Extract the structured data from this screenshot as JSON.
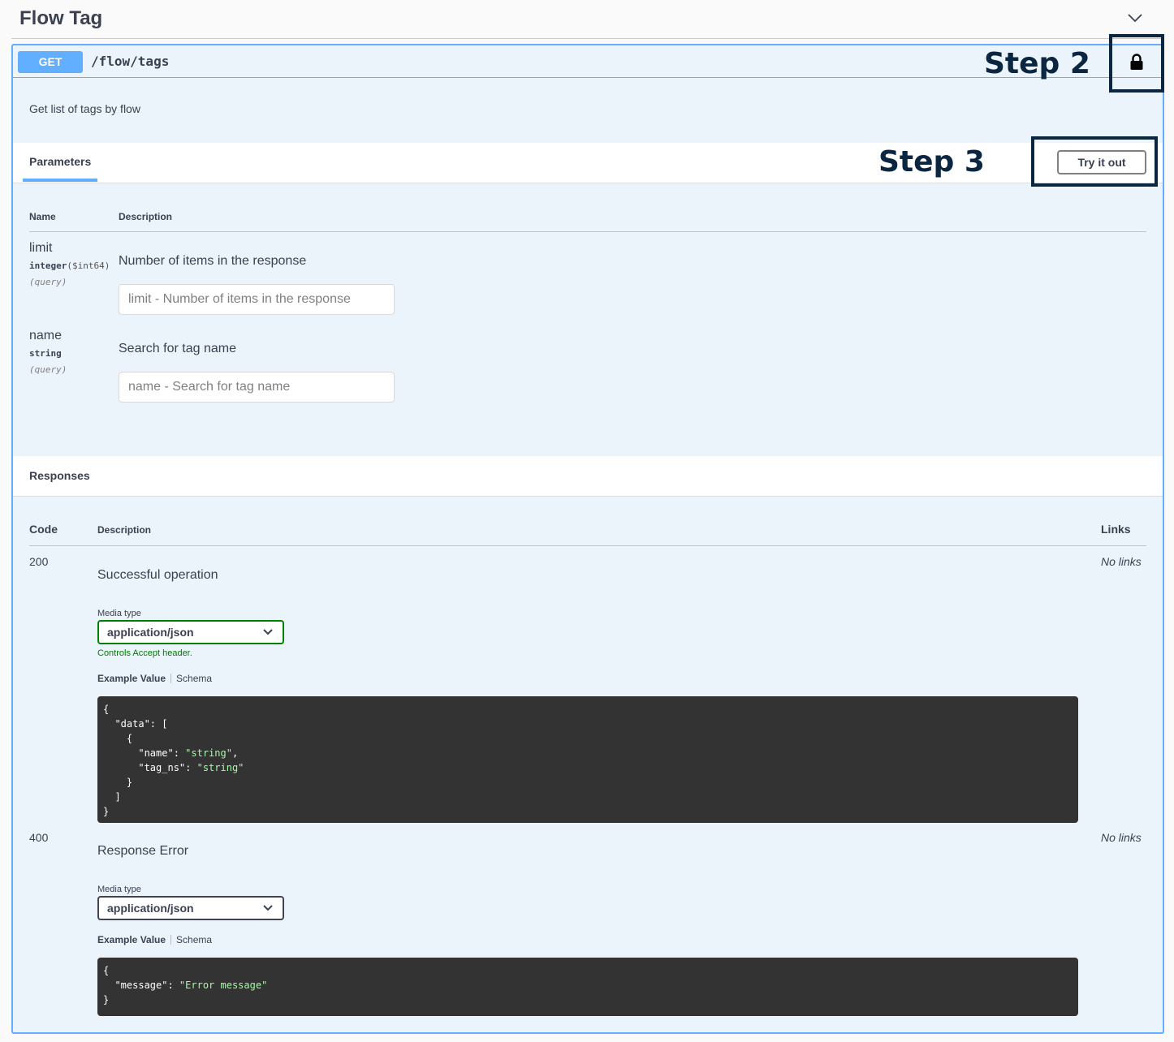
{
  "tag": {
    "title": "Flow Tag",
    "collapse_icon": "chevron-down-icon"
  },
  "operation": {
    "method": "GET",
    "path": "/flow/tags",
    "description": "Get list of tags by flow",
    "step2_label": "Step 2",
    "lock_icon": "lock-icon"
  },
  "parameters": {
    "tab_label": "Parameters",
    "step3_label": "Step 3",
    "try_button": "Try it out",
    "col_name": "Name",
    "col_description": "Description",
    "items": [
      {
        "name": "limit",
        "type": "integer",
        "format": "($int64)",
        "in": "(query)",
        "description": "Number of items in the response",
        "placeholder": "limit - Number of items in the response"
      },
      {
        "name": "name",
        "type": "string",
        "format": "",
        "in": "(query)",
        "description": "Search for tag name",
        "placeholder": "name - Search for tag name"
      }
    ]
  },
  "responses": {
    "title": "Responses",
    "col_code": "Code",
    "col_description": "Description",
    "col_links": "Links",
    "items": [
      {
        "code": "200",
        "description": "Successful operation",
        "links": "No links",
        "media_type_label": "Media type",
        "media_type": "application/json",
        "controls_note": "Controls Accept header.",
        "example_tab": "Example Value",
        "schema_tab": "Schema"
      },
      {
        "code": "400",
        "description": "Response Error",
        "links": "No links",
        "media_type_label": "Media type",
        "media_type": "application/json",
        "example_tab": "Example Value",
        "schema_tab": "Schema"
      }
    ]
  },
  "colors": {
    "get_blue": "#61affe",
    "op_background": "#ebf3fb",
    "annotation_navy": "#0b2640",
    "code_bg": "#333333",
    "string_green": "#a2fca2"
  }
}
